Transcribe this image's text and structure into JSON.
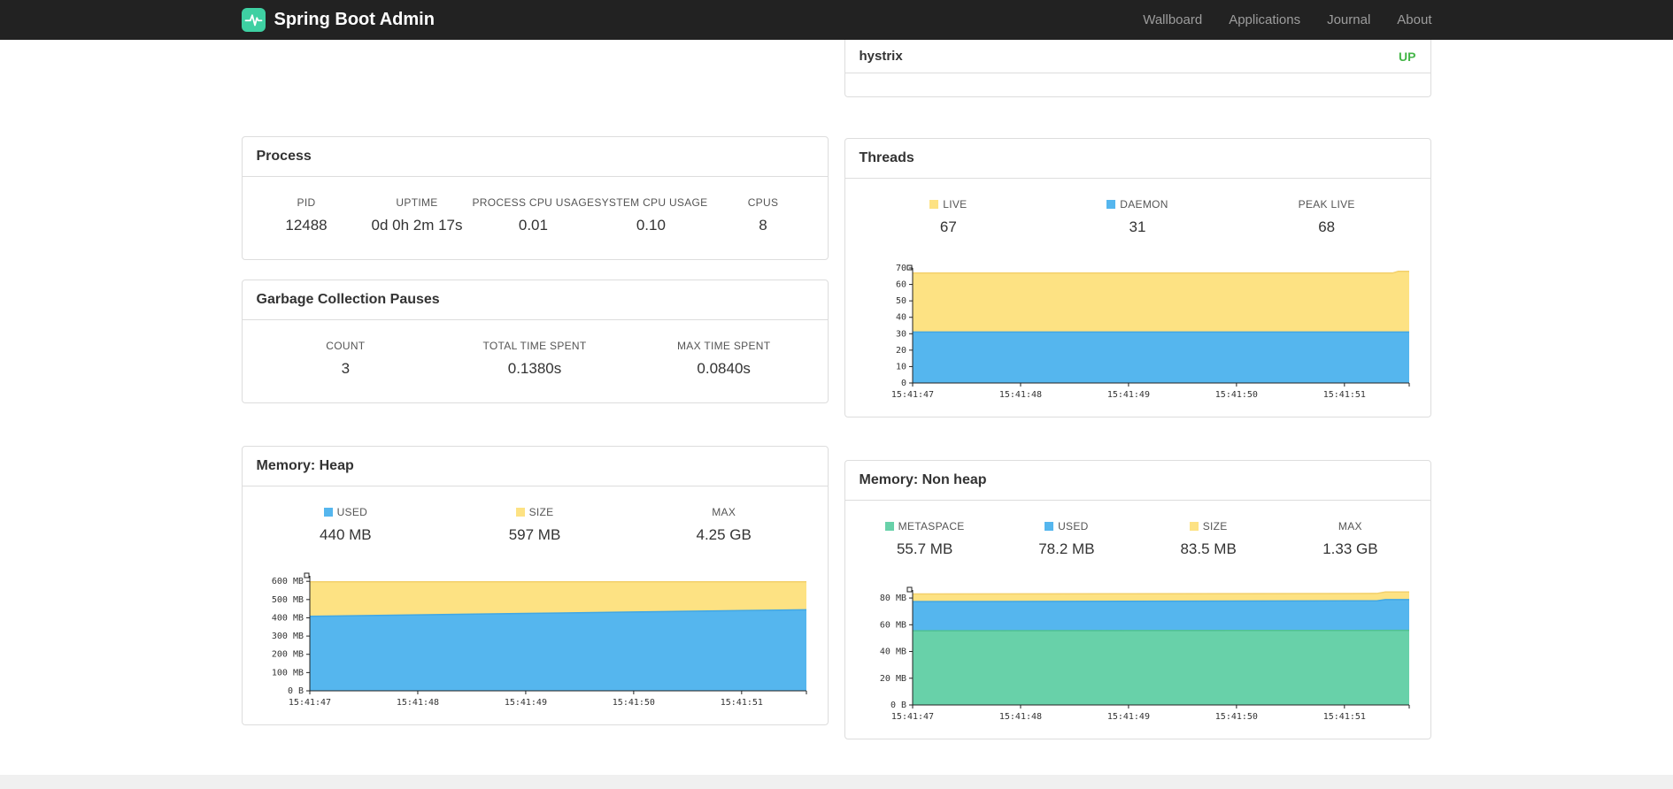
{
  "navbar": {
    "brand": "Spring Boot Admin",
    "links": [
      {
        "label": "Wallboard"
      },
      {
        "label": "Applications"
      },
      {
        "label": "Journal"
      },
      {
        "label": "About"
      }
    ]
  },
  "applications_panel": {
    "rows": [
      {
        "name": "hystrix",
        "status": "UP",
        "status_color": "#45b649"
      }
    ]
  },
  "process": {
    "title": "Process",
    "metrics": [
      {
        "label": "PID",
        "value": "12488"
      },
      {
        "label": "UPTIME",
        "value": "0d 0h 2m 17s"
      },
      {
        "label": "PROCESS CPU USAGE",
        "value": "0.01"
      },
      {
        "label": "SYSTEM CPU USAGE",
        "value": "0.10"
      },
      {
        "label": "CPUS",
        "value": "8"
      }
    ]
  },
  "gc": {
    "title": "Garbage Collection Pauses",
    "metrics": [
      {
        "label": "COUNT",
        "value": "3"
      },
      {
        "label": "TOTAL TIME SPENT",
        "value": "0.1380s"
      },
      {
        "label": "MAX TIME SPENT",
        "value": "0.0840s"
      }
    ]
  },
  "threads": {
    "title": "Threads",
    "metrics": [
      {
        "label": "LIVE",
        "value": "67",
        "color": "#fde283"
      },
      {
        "label": "DAEMON",
        "value": "31",
        "color": "#55b6ee"
      },
      {
        "label": "PEAK LIVE",
        "value": "68"
      }
    ]
  },
  "memory_heap": {
    "title": "Memory: Heap",
    "metrics": [
      {
        "label": "USED",
        "value": "440 MB",
        "color": "#55b6ee"
      },
      {
        "label": "SIZE",
        "value": "597 MB",
        "color": "#fde283"
      },
      {
        "label": "MAX",
        "value": "4.25 GB"
      }
    ]
  },
  "memory_nonheap": {
    "title": "Memory: Non heap",
    "metrics": [
      {
        "label": "METASPACE",
        "value": "55.7 MB",
        "color": "#68d1a9"
      },
      {
        "label": "USED",
        "value": "78.2 MB",
        "color": "#55b6ee"
      },
      {
        "label": "SIZE",
        "value": "83.5 MB",
        "color": "#fde283"
      },
      {
        "label": "MAX",
        "value": "1.33 GB"
      }
    ]
  },
  "chart_data": [
    {
      "id": "threads",
      "type": "area",
      "title": "Threads",
      "x_tick_labels": [
        "15:41:47",
        "15:41:48",
        "15:41:49",
        "15:41:50",
        "15:41:51"
      ],
      "x_range": [
        0,
        4.6
      ],
      "y_range": [
        0,
        70
      ],
      "y_ticks": [
        [
          0,
          "0"
        ],
        [
          10,
          "10"
        ],
        [
          20,
          "20"
        ],
        [
          30,
          "30"
        ],
        [
          40,
          "40"
        ],
        [
          50,
          "50"
        ],
        [
          60,
          "60"
        ],
        [
          70,
          "70"
        ]
      ],
      "series": [
        {
          "name": "LIVE",
          "fill": "#fde283",
          "stroke": "#f3d06b",
          "points": [
            [
              0,
              67
            ],
            [
              4.45,
              67
            ],
            [
              4.5,
              68
            ],
            [
              4.6,
              68
            ]
          ]
        },
        {
          "name": "DAEMON",
          "fill": "#55b6ee",
          "stroke": "#41a7e4",
          "points": [
            [
              0,
              31
            ],
            [
              4.6,
              31
            ]
          ]
        }
      ]
    },
    {
      "id": "memory-heap",
      "type": "area",
      "title": "Memory: Heap",
      "x_tick_labels": [
        "15:41:47",
        "15:41:48",
        "15:41:49",
        "15:41:50",
        "15:41:51"
      ],
      "x_range": [
        0,
        4.6
      ],
      "y_range": [
        0,
        630
      ],
      "y_ticks": [
        [
          0,
          "0 B"
        ],
        [
          100,
          "100 MB"
        ],
        [
          200,
          "200 MB"
        ],
        [
          300,
          "300 MB"
        ],
        [
          400,
          "400 MB"
        ],
        [
          500,
          "500 MB"
        ],
        [
          600,
          "600 MB"
        ]
      ],
      "series": [
        {
          "name": "SIZE",
          "fill": "#fde283",
          "stroke": "#f3d06b",
          "points": [
            [
              0,
              597
            ],
            [
              4.6,
              597
            ]
          ]
        },
        {
          "name": "USED",
          "fill": "#55b6ee",
          "stroke": "#41a7e4",
          "points": [
            [
              0,
              408
            ],
            [
              1,
              416
            ],
            [
              2,
              424
            ],
            [
              3,
              432
            ],
            [
              4,
              440
            ],
            [
              4.6,
              444
            ]
          ]
        }
      ]
    },
    {
      "id": "memory-nonheap",
      "type": "area",
      "title": "Memory: Non heap",
      "x_tick_labels": [
        "15:41:47",
        "15:41:48",
        "15:41:49",
        "15:41:50",
        "15:41:51"
      ],
      "x_range": [
        0,
        4.6
      ],
      "y_range": [
        0,
        86
      ],
      "y_ticks": [
        [
          0,
          "0 B"
        ],
        [
          20,
          "20 MB"
        ],
        [
          40,
          "40 MB"
        ],
        [
          60,
          "60 MB"
        ],
        [
          80,
          "80 MB"
        ]
      ],
      "series": [
        {
          "name": "SIZE",
          "fill": "#fde283",
          "stroke": "#f3d06b",
          "points": [
            [
              0,
              83
            ],
            [
              4.3,
              83.4
            ],
            [
              4.38,
              84.5
            ],
            [
              4.6,
              84.5
            ]
          ]
        },
        {
          "name": "USED",
          "fill": "#55b6ee",
          "stroke": "#41a7e4",
          "points": [
            [
              0,
              77.3
            ],
            [
              4.3,
              77.9
            ],
            [
              4.38,
              78.8
            ],
            [
              4.6,
              78.8
            ]
          ]
        },
        {
          "name": "METASPACE",
          "fill": "#68d1a9",
          "stroke": "#50c193",
          "points": [
            [
              0,
              55.5
            ],
            [
              4.6,
              55.8
            ]
          ]
        }
      ]
    }
  ]
}
